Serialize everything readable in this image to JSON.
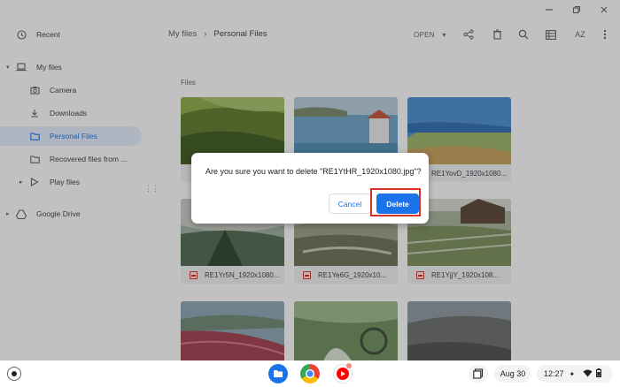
{
  "sidebar": {
    "items": [
      {
        "label": "Recent",
        "icon": "clock-icon"
      },
      {
        "label": "My files",
        "icon": "laptop-icon"
      },
      {
        "label": "Camera",
        "icon": "camera-icon"
      },
      {
        "label": "Downloads",
        "icon": "download-icon"
      },
      {
        "label": "Personal Files",
        "icon": "folder-icon"
      },
      {
        "label": "Recovered files from ...",
        "icon": "folder-icon"
      },
      {
        "label": "Play files",
        "icon": "play-icon"
      },
      {
        "label": "Google Drive",
        "icon": "drive-icon"
      }
    ]
  },
  "breadcrumb": {
    "root": "My files",
    "sep": "›",
    "current": "Personal Files"
  },
  "toolbar": {
    "open_label": "OPEN",
    "open_caret": "▾",
    "sort_label": "AZ"
  },
  "files": {
    "section_label": "Files",
    "tiles": [
      {
        "name": ""
      },
      {
        "name": ""
      },
      {
        "name": "RE1YovD_1920x1080..."
      },
      {
        "name": "RE1Yr5N_1920x1080..."
      },
      {
        "name": "RE1Ye6G_1920x10..."
      },
      {
        "name": "RE1YjjY_1920x108..."
      },
      {
        "name": ""
      },
      {
        "name": ""
      },
      {
        "name": ""
      }
    ]
  },
  "dialog": {
    "message": "Are you sure you want to delete \"RE1YtHR_1920x1080.jpg\"?",
    "cancel_label": "Cancel",
    "delete_label": "Delete"
  },
  "shelf": {
    "date": "Aug 30",
    "time": "12:27"
  },
  "colors": {
    "accent": "#1a73e8",
    "highlight": "#d93025"
  }
}
